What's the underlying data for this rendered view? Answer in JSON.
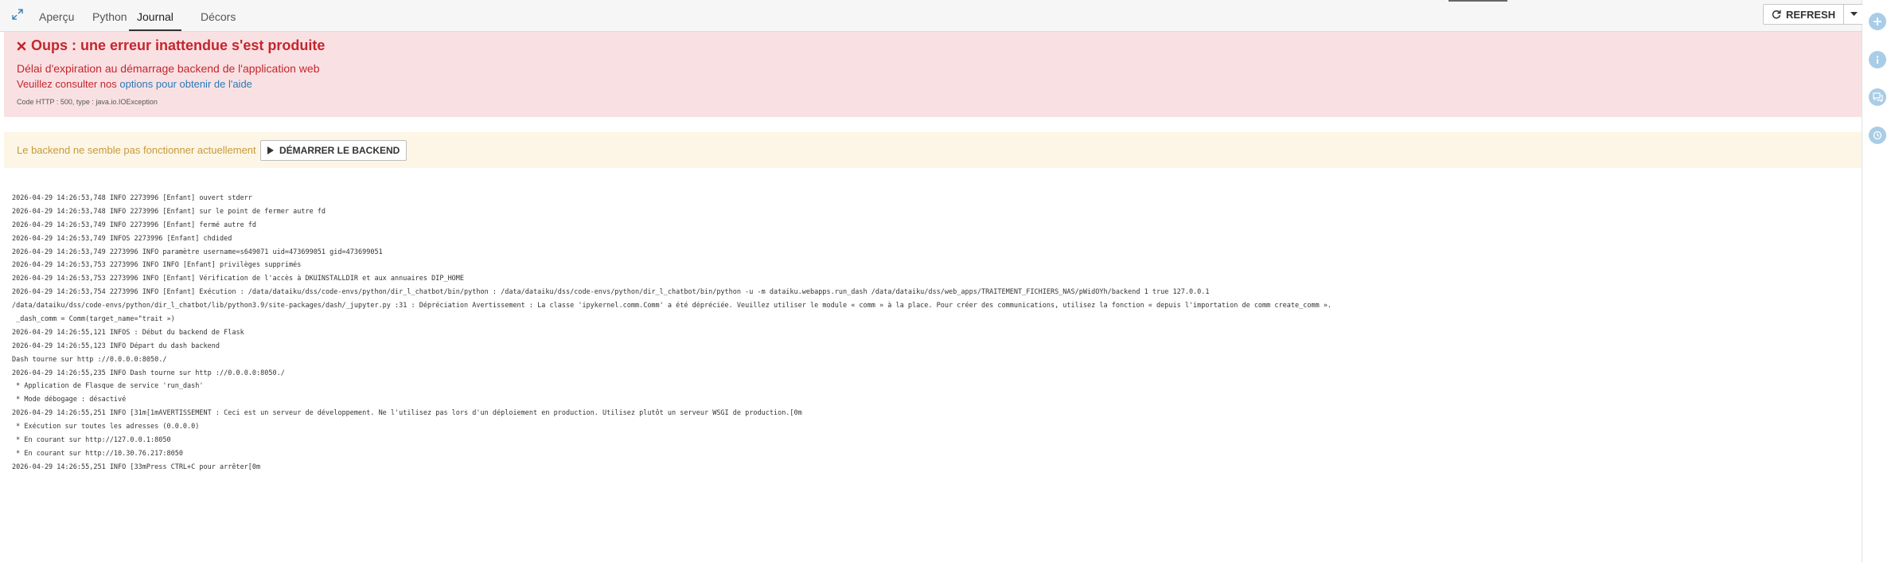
{
  "tabs": [
    {
      "label": "Aperçu"
    },
    {
      "label": "Python"
    },
    {
      "label": "Journal",
      "active": true
    },
    {
      "label": "Décors"
    }
  ],
  "toolbar": {
    "refresh_label": "REFRESH"
  },
  "error": {
    "title": "Oups : une erreur inattendue s'est produite",
    "message": "Délai d'expiration au démarrage backend de l'application web",
    "help_prefix": "Veuillez consulter nos ",
    "help_link": "options pour obtenir de l'aide",
    "code": "Code HTTP : 500, type : java.io.IOException",
    "color": "#c4262e",
    "background": "#f9e1e3"
  },
  "warning": {
    "text": "Le backend ne semble pas fonctionner actuellement",
    "start_label": "DÉMARRER LE BACKEND",
    "color": "#c69a3c",
    "background": "#fdf6e6"
  },
  "log_lines": [
    "2026-04-29 14:26:53,748 INFO 2273996 [Enfant] ouvert stderr",
    "2026-04-29 14:26:53,748 INFO 2273996 [Enfant] sur le point de fermer autre fd",
    "2026-04-29 14:26:53,749 INFO 2273996 [Enfant] fermé autre fd",
    "2026-04-29 14:26:53,749 INFOS 2273996 [Enfant] chdided",
    "2026-04-29 14:26:53,749 2273996 INFO paramètre username=s649071 uid=473699051 gid=473699051",
    "2026-04-29 14:26:53,753 2273996 INFO INFO [Enfant] privilèges supprimés",
    "2026-04-29 14:26:53,753 2273996 INFO [Enfant] Vérification de l'accès à DKUINSTALLDIR et aux annuaires DIP_HOME",
    "2026-04-29 14:26:53,754 2273996 INFO [Enfant] Exécution : /data/dataiku/dss/code-envs/python/dir_l_chatbot/bin/python : /data/dataiku/dss/code-envs/python/dir_l_chatbot/bin/python -u -m dataiku.webapps.run_dash /data/dataiku/dss/web_apps/TRAITEMENT_FICHIERS_NAS/pWidOYh/backend 1 true 127.0.0.1",
    "/data/dataiku/dss/code-envs/python/dir_l_chatbot/lib/python3.9/site-packages/dash/_jupyter.py :31 : Dépréciation Avertissement : La classe 'ipykernel.comm.Comm' a été dépréciée. Veuillez utiliser le module « comm » à la place. Pour créer des communications, utilisez la fonction « depuis l'importation de comm create_comm ».",
    " _dash_comm = Comm(target_name=\"trait »)",
    "2026-04-29 14:26:55,121 INFOS : Début du backend de Flask",
    "2026-04-29 14:26:55,123 INFO Départ du dash backend",
    "Dash tourne sur http ://0.0.0.0:8050./",
    "2026-04-29 14:26:55,235 INFO Dash tourne sur http ://0.0.0.0:8050./",
    " * Application de Flasque de service 'run_dash'",
    " * Mode débogage : désactivé",
    "2026-04-29 14:26:55,251 INFO [31m[1mAVERTISSEMENT : Ceci est un serveur de développement. Ne l'utilisez pas lors d'un déploiement en production. Utilisez plutôt un serveur WSGI de production.[0m",
    " * Exécution sur toutes les adresses (0.0.0.0)",
    " * En courant sur http://127.0.0.1:8050",
    " * En courant sur http://10.30.76.217:8050",
    "2026-04-29 14:26:55,251 INFO [33mPress CTRL+C pour arrêter[0m"
  ],
  "icons": {
    "expand": "expand-icon",
    "refresh": "refresh-icon",
    "caret": "chevron-down-icon",
    "play": "play-icon",
    "rail": [
      "plus-icon",
      "info-icon",
      "chat-icon",
      "history-icon"
    ]
  },
  "rail_color": "#a9cde6"
}
